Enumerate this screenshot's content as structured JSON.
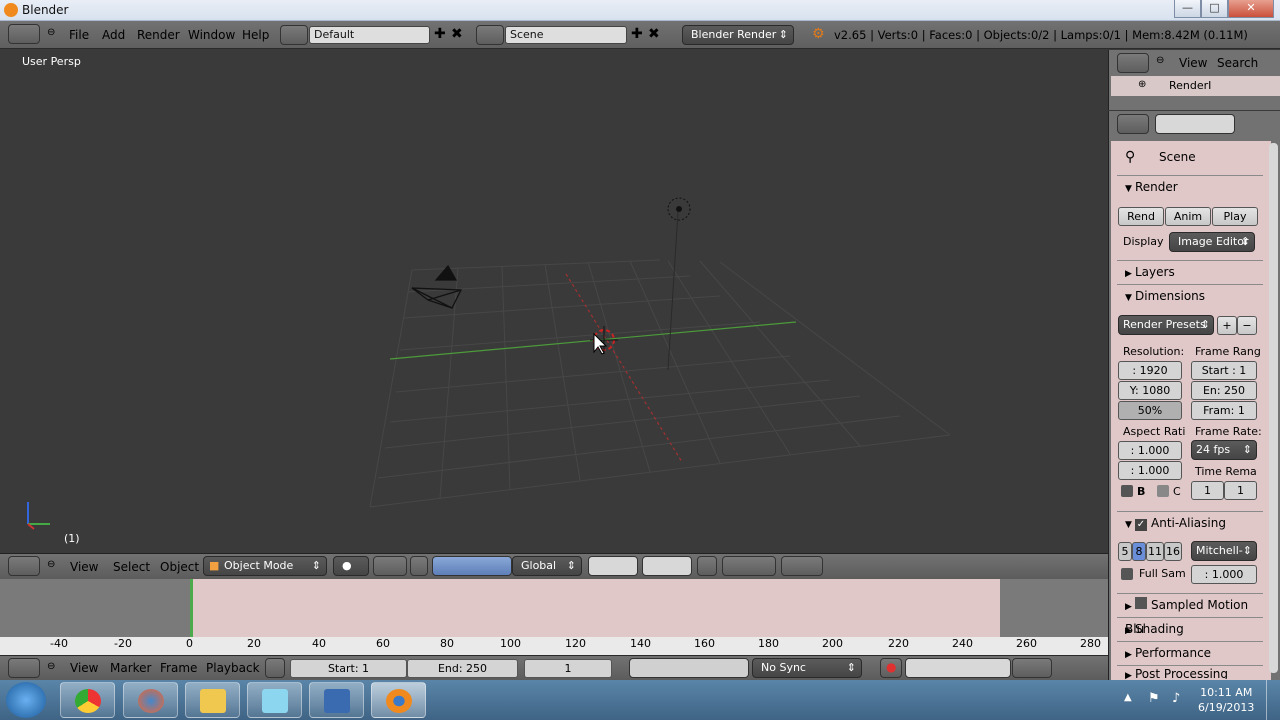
{
  "window": {
    "title": "Blender",
    "buttons": [
      "—",
      "□",
      "✕"
    ]
  },
  "topbar": {
    "menus": [
      "File",
      "Add",
      "Render",
      "Window",
      "Help"
    ],
    "layout": "Default",
    "scene": "Scene",
    "engine": "Blender Render",
    "stats": "v2.65 | Verts:0 | Faces:0 | Objects:0/2 | Lamps:0/1 | Mem:8.42M (0.11M)"
  },
  "viewport": {
    "label": "User Persp",
    "frame": "(1)"
  },
  "view_header": {
    "menus": [
      "View",
      "Select",
      "Object"
    ],
    "mode": "Object Mode",
    "orientation": "Global"
  },
  "timeline": {
    "ticks": [
      "-40",
      "-20",
      "0",
      "20",
      "40",
      "60",
      "80",
      "100",
      "120",
      "140",
      "160",
      "180",
      "200",
      "220",
      "240",
      "260",
      "280"
    ],
    "menus": [
      "View",
      "Marker",
      "Frame",
      "Playback"
    ],
    "start": "Start: 1",
    "end": "End: 250",
    "current": "1",
    "sync": "No Sync"
  },
  "outliner": {
    "view": "View",
    "search": "Search",
    "item": "RenderI"
  },
  "properties": {
    "breadcrumb": "Scene",
    "render_panel": "Render",
    "render_btn": "Rend",
    "anim_btn": "Anim",
    "play_btn": "Play",
    "display_label": "Display",
    "display_value": "Image Editor",
    "layers_panel": "Layers",
    "dimensions_panel": "Dimensions",
    "presets": "Render Presets",
    "resolution_label": "Resolution:",
    "res_x": ": 1920",
    "res_y": "Y: 1080",
    "res_pct": "50%",
    "frame_range_label": "Frame Rang",
    "frame_start": "Start : 1",
    "frame_end": "En: 250",
    "frame_step": "Fram: 1",
    "aspect_label": "Aspect Rati",
    "aspect_x": ": 1.000",
    "aspect_y": ": 1.000",
    "fps_label": "Frame Rate:",
    "fps_value": "24 fps",
    "time_remap_label": "Time Rema",
    "time_remap_old": "1",
    "time_remap_new": "1",
    "border_b": "B",
    "border_c": "C",
    "aa_panel": "Anti-Aliasing",
    "aa_samples": [
      "5",
      "8",
      "11",
      "16"
    ],
    "aa_filter": "Mitchell-",
    "full_sample": "Full Sam",
    "filter_size": ": 1.000",
    "motion_blur_panel": "Sampled Motion Blu",
    "shading_panel": "Shading",
    "performance_panel": "Performance",
    "post_panel": "Post Processing"
  },
  "taskbar": {
    "time": "10:11 AM",
    "date": "6/19/2013"
  }
}
